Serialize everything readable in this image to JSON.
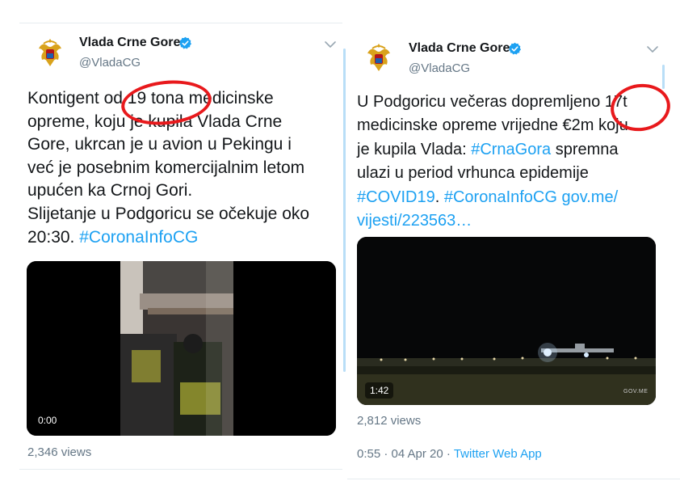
{
  "tweets": [
    {
      "display_name": "Vlada Crne Gore",
      "handle": "@VladaCG",
      "text_lines": [
        [
          "Kontigent od 19 tona medicinske"
        ],
        [
          "opreme, koju je kupila Vlada Crne"
        ],
        [
          "Gore, ukrcan je u avion u Pekingu i"
        ],
        [
          "već je posebnim komercijalnim letom"
        ],
        [
          "upućen ka Crnoj Gori."
        ],
        [
          "Slijetanje u Podgoricu se očekuje oko"
        ],
        [
          "20:30. ",
          "#CoronaInfoCG"
        ]
      ],
      "video_time": "0:00",
      "views": "2,346 views"
    },
    {
      "display_name": "Vlada Crne Gore",
      "handle": "@VladaCG",
      "text_lines": [
        [
          "U Podgoricu večeras dopremljeno 17t"
        ],
        [
          "medicinske opreme vrijedne €2m koju"
        ],
        [
          "je kupila Vlada: ",
          "#CrnaGora",
          " spremna"
        ],
        [
          "ulazi u period vrhunca epidemije"
        ],
        [
          "#COVID19",
          ". ",
          "#CoronaInfoCG",
          " ",
          "gov.me/"
        ],
        [
          "vijesti/223563…"
        ]
      ],
      "video_time": "1:42",
      "video_watermark": "GOV.ME",
      "views": "2,812 views",
      "meta_time": "0:55 · 04 Apr 20 · ",
      "meta_app": "Twitter Web App"
    }
  ],
  "icons": {
    "verified": "verified-badge-icon",
    "caret": "chevron-down-icon",
    "avatar": "montenegro-coat-of-arms"
  },
  "colors": {
    "link": "#1da1f2",
    "secondary_text": "#657786",
    "verified": "#1da1f2",
    "annotation": "#e8191c"
  }
}
